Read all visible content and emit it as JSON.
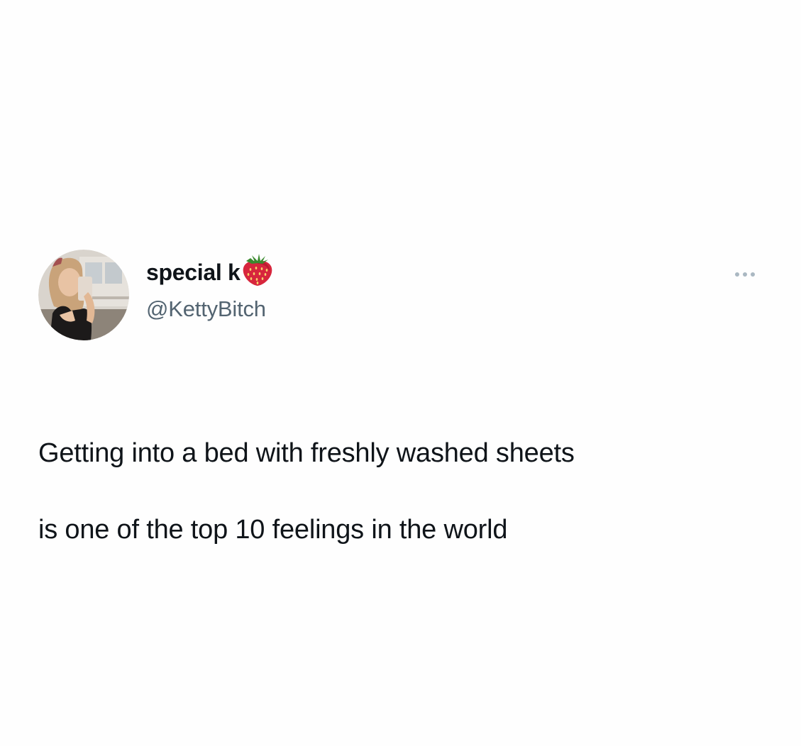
{
  "tweet": {
    "author": {
      "display_name": "special k",
      "name_emoji": "strawberry-icon",
      "handle": "@KettyBitch",
      "avatar": "profile-photo"
    },
    "more_menu_icon": "more-horizontal-icon",
    "text_line_1": "Getting into a bed with freshly washed sheets",
    "text_line_2": "is one of the top 10 feelings in the world"
  },
  "colors": {
    "background": "#fefefe",
    "text_primary": "#0f1419",
    "text_secondary": "#536471",
    "more_dots": "#aab8c2",
    "strawberry": "#d7263d"
  }
}
